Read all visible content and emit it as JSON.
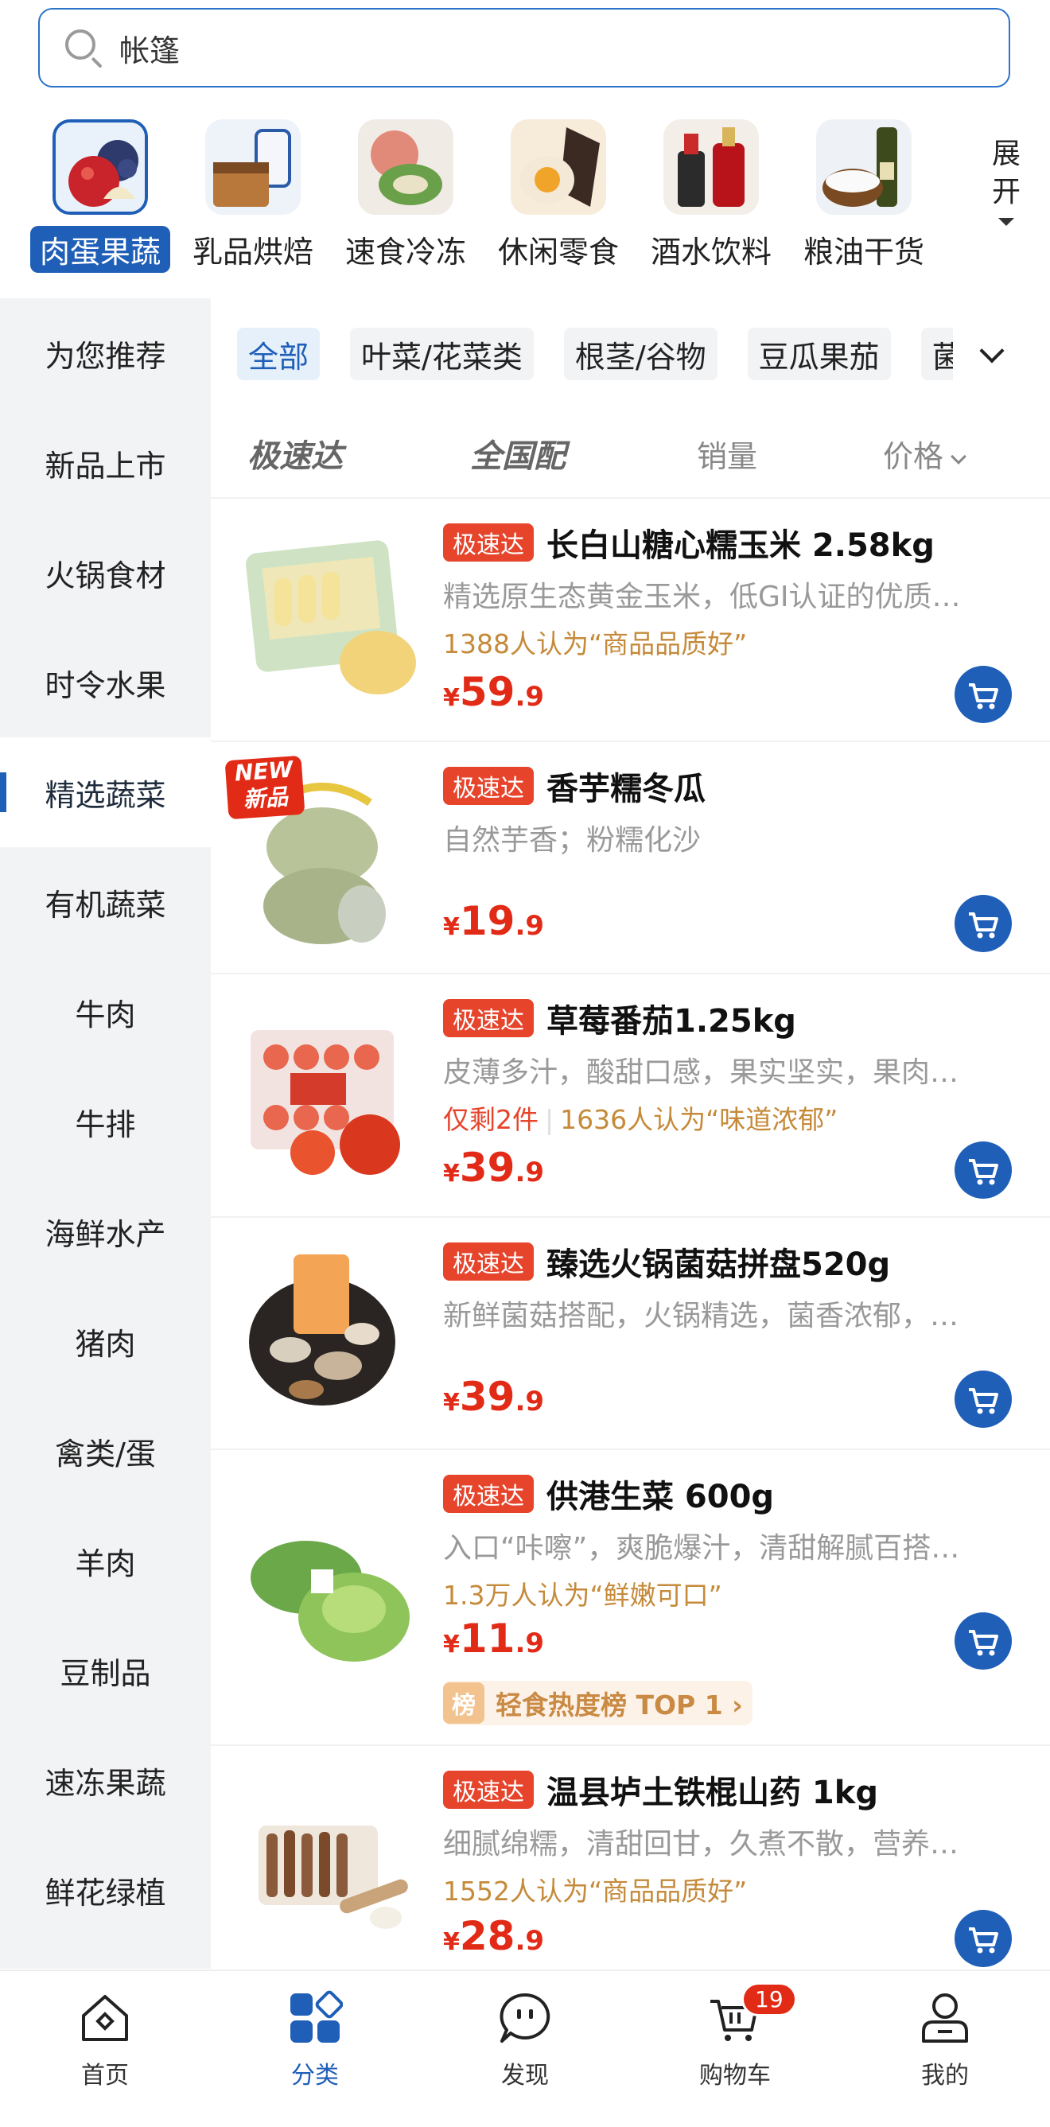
{
  "search": {
    "query": "帐篷"
  },
  "top_categories": [
    {
      "label": "肉蛋果蔬",
      "active": true
    },
    {
      "label": "乳品烘焙",
      "active": false
    },
    {
      "label": "速食冷冻",
      "active": false
    },
    {
      "label": "休闲零食",
      "active": false
    },
    {
      "label": "酒水饮料",
      "active": false
    },
    {
      "label": "粮油干货",
      "active": false
    }
  ],
  "expand": {
    "line1": "展",
    "line2": "开"
  },
  "sidebar": {
    "items": [
      "为您推荐",
      "新品上市",
      "火锅食材",
      "时令水果",
      "精选蔬菜",
      "有机蔬菜",
      "牛肉",
      "牛排",
      "海鲜水产",
      "猪肉",
      "禽类/蛋",
      "羊肉",
      "豆制品",
      "速冻果蔬",
      "鲜花绿植"
    ],
    "active": "精选蔬菜"
  },
  "chips": [
    "全部",
    "叶菜/花菜类",
    "根茎/谷物",
    "豆瓜果茄",
    "菌"
  ],
  "sort": {
    "express": "极速达",
    "national": "全国配",
    "sales": "销量",
    "price": "价格"
  },
  "products": [
    {
      "tag": "极速达",
      "title": "长白山糖心糯玉米  2.58kg",
      "desc": "精选原生态黄金玉米，低GI认证的优质…",
      "social": "1388人认为“商品品质好”",
      "price_int": "59",
      "price_dec": ".9"
    },
    {
      "tag": "极速达",
      "title": "香芋糯冬瓜",
      "desc": "自然芋香；粉糯化沙",
      "social": "",
      "price_int": "19",
      "price_dec": ".9",
      "new_badge_line1": "NEW",
      "new_badge_line2": "新品"
    },
    {
      "tag": "极速达",
      "title": "草莓番茄1.25kg",
      "desc": "皮薄多汁，酸甜口感，果实坚实，果肉…",
      "stock": "仅剩2件",
      "social": "1636人认为“味道浓郁”",
      "price_int": "39",
      "price_dec": ".9"
    },
    {
      "tag": "极速达",
      "title": "臻选火锅菌菇拼盘520g",
      "desc": "新鲜菌菇搭配，火锅精选，菌香浓郁，…",
      "social": "",
      "price_int": "39",
      "price_dec": ".9"
    },
    {
      "tag": "极速达",
      "title": "供港生菜 600g",
      "desc": "入口“咔嚓”，爽脆爆汁，清甜解腻百搭…",
      "social": "1.3万人认为“鲜嫩可口”",
      "price_int": "11",
      "price_dec": ".9",
      "rank_badge": "榜",
      "rank": "轻食热度榜 TOP 1 ›"
    },
    {
      "tag": "极速达",
      "title": "温县垆土铁棍山药 1kg",
      "desc": "细腻绵糯，清甜回甘，久煮不散，营养…",
      "social": "1552人认为“商品品质好”",
      "price_int": "28",
      "price_dec": ".9"
    }
  ],
  "currency": "¥",
  "bottom_nav": [
    {
      "label": "首页",
      "icon": "home-icon"
    },
    {
      "label": "分类",
      "icon": "category-icon",
      "active": true
    },
    {
      "label": "发现",
      "icon": "discover-icon"
    },
    {
      "label": "购物车",
      "icon": "cart-icon",
      "badge": "19"
    },
    {
      "label": "我的",
      "icon": "profile-icon"
    }
  ],
  "colors": {
    "accent": "#1f5fb8",
    "price": "#e22b17",
    "tag": "#e6442b"
  }
}
